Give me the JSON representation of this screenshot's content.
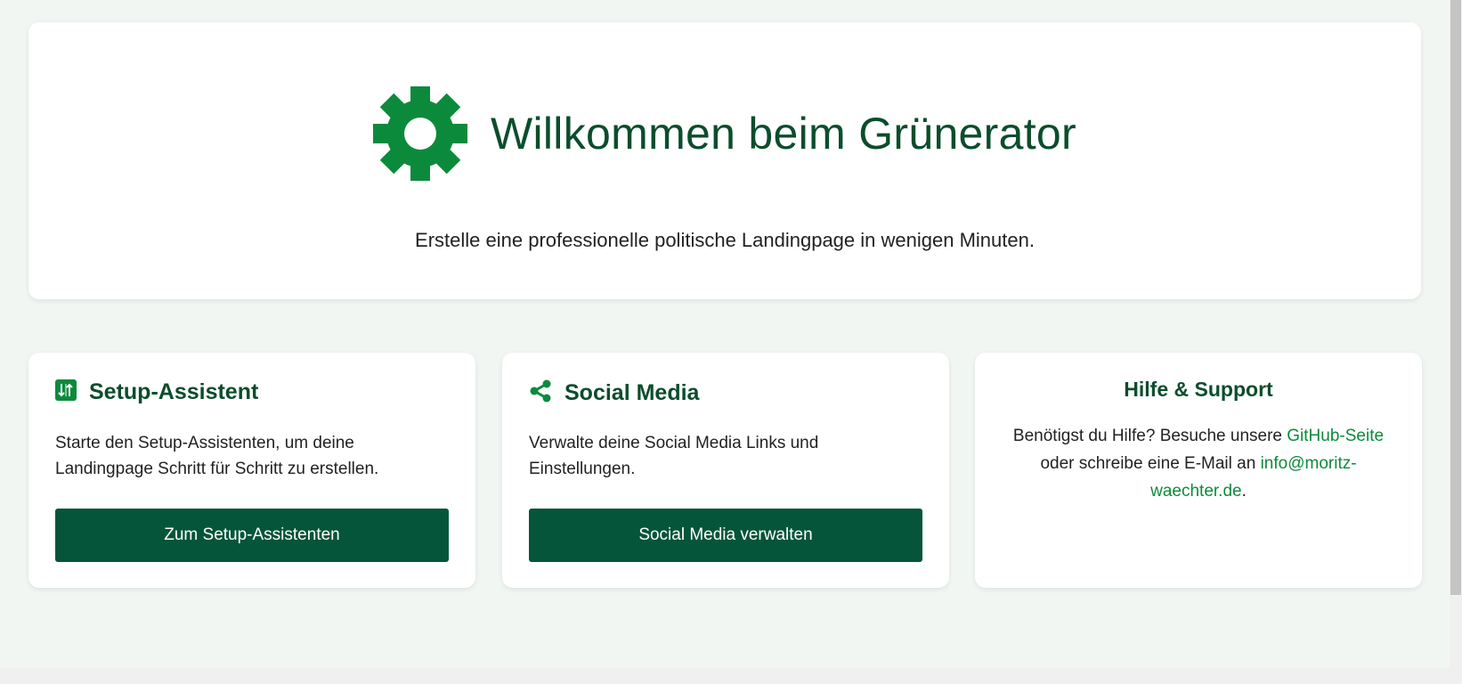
{
  "hero": {
    "icon": "gear-icon",
    "title": "Willkommen beim Grünerator",
    "subtitle": "Erstelle eine professionelle politische Landingpage in wenigen Minuten."
  },
  "cards": {
    "setup": {
      "icon": "setup-wizard-icon",
      "title": "Setup-Assistent",
      "text": "Starte den Setup-Assistenten, um deine Landingpage Schritt für Schritt zu erstellen.",
      "button": "Zum Setup-Assistenten"
    },
    "social": {
      "icon": "share-icon",
      "title": "Social Media",
      "text": "Verwalte deine Social Media Links und Einstellungen.",
      "button": "Social Media verwalten"
    },
    "help": {
      "title": "Hilfe & Support",
      "text_before": "Benötigst du Hilfe? Besuche unsere ",
      "github_link": "GitHub-Seite",
      "text_middle": " oder schreibe eine E-Mail an ",
      "email_link": "info@moritz-waechter.de",
      "text_after": "."
    }
  },
  "colors": {
    "primary_dark": "#05553a",
    "primary": "#0c8a3c",
    "heading": "#0b4d2c",
    "background": "#f1f6f2"
  }
}
